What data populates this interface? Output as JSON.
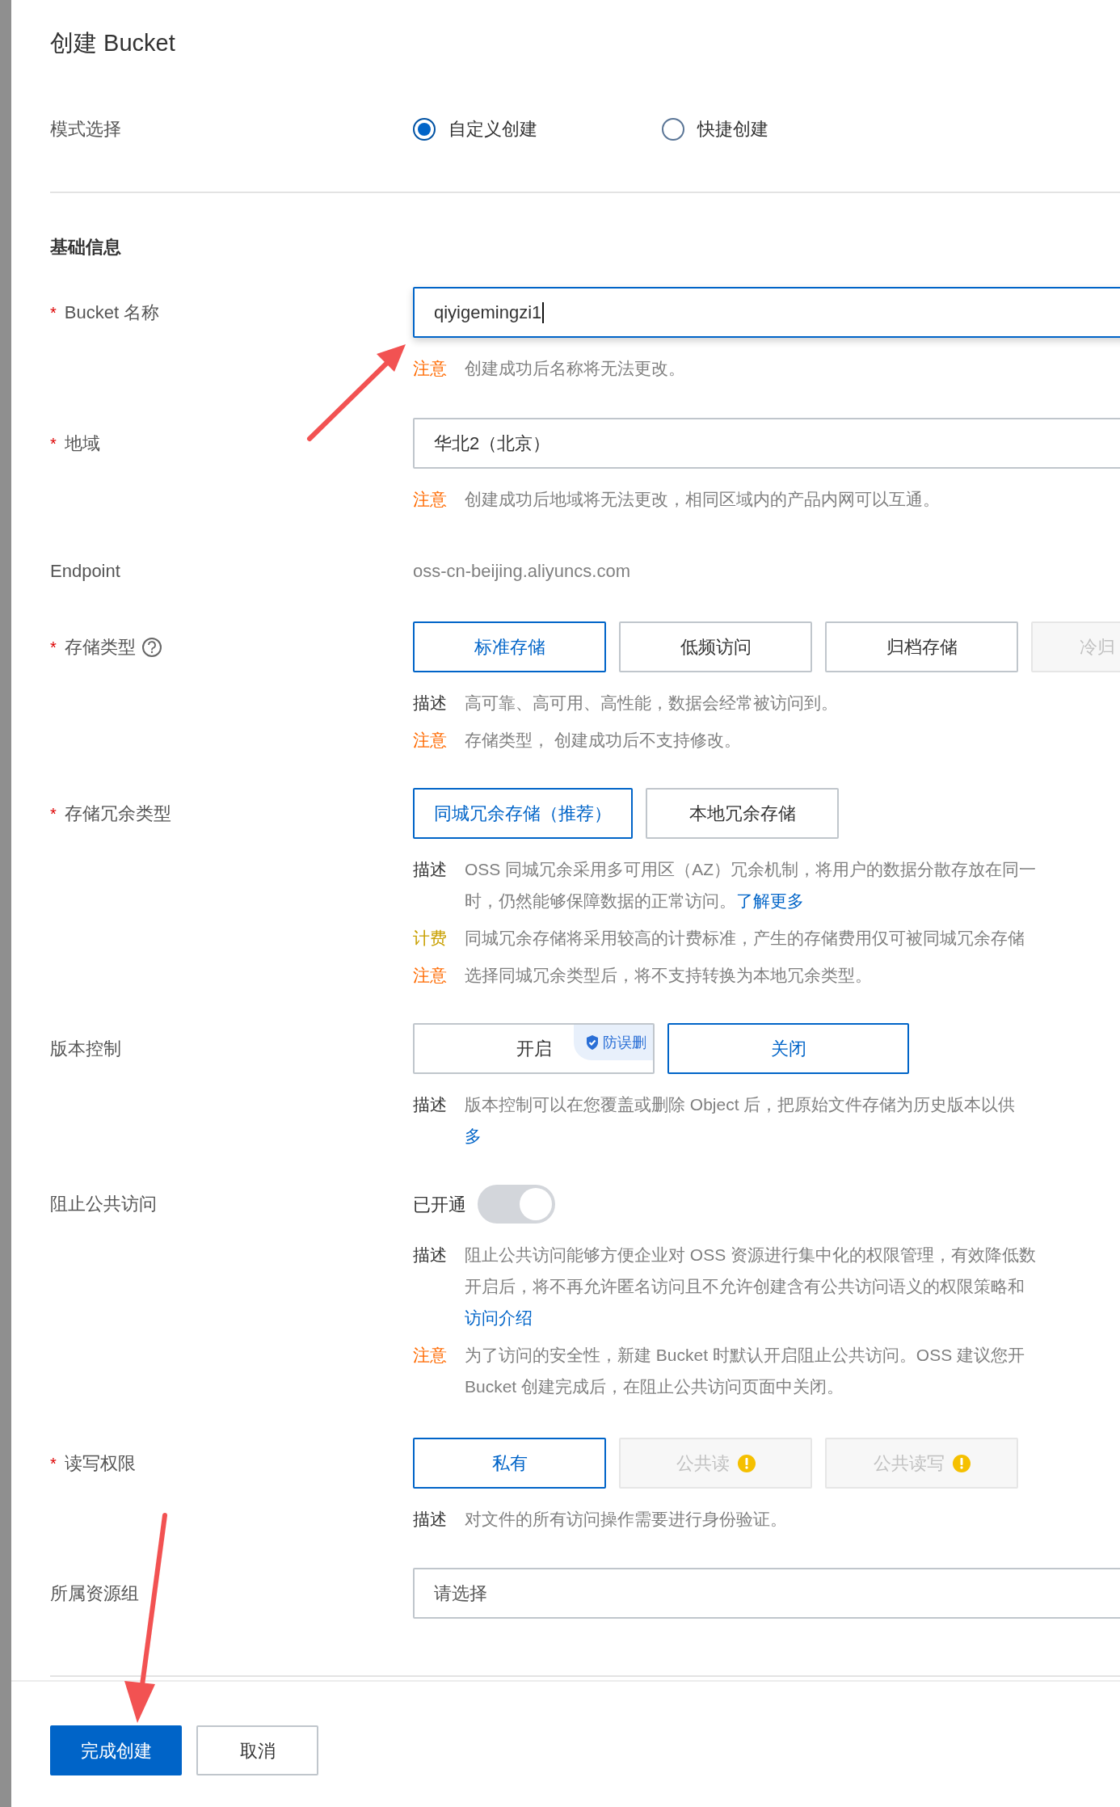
{
  "title": "创建 Bucket",
  "mode": {
    "label": "模式选择",
    "options": [
      {
        "label": "自定义创建",
        "selected": true
      },
      {
        "label": "快捷创建",
        "selected": false
      }
    ]
  },
  "section": "基础信息",
  "fields": [
    {
      "kind": "input",
      "label": "Bucket 名称",
      "required_mark": "*",
      "value": "qiyigemingzi1",
      "focused": true,
      "notes": [
        {
          "kind": "note",
          "tag": "注意",
          "lines": [
            {
              "text": "创建成功后名称将无法更改。"
            }
          ]
        }
      ]
    },
    {
      "kind": "select",
      "label": "地域",
      "required_mark": "*",
      "value": "华北2（北京）",
      "notes": [
        {
          "kind": "note",
          "tag": "注意",
          "lines": [
            {
              "text": "创建成功后地域将无法更改，相同区域内的产品内网可以互通。"
            }
          ]
        }
      ]
    },
    {
      "kind": "text",
      "label": "Endpoint",
      "value": "oss-cn-beijing.aliyuncs.com"
    },
    {
      "kind": "choice",
      "label": "存储类型",
      "required_mark": "*",
      "help": true,
      "options": [
        {
          "label": "标准存储",
          "selected": true,
          "disabled": false
        },
        {
          "label": "低频访问",
          "selected": false,
          "disabled": false
        },
        {
          "label": "归档存储",
          "selected": false,
          "disabled": false
        },
        {
          "label": "冷归",
          "selected": false,
          "disabled": true
        }
      ],
      "notes": [
        {
          "kind": "desc",
          "tag": "描述",
          "lines": [
            {
              "text": "高可靠、高可用、高性能，数据会经常被访问到。"
            }
          ]
        },
        {
          "kind": "note",
          "tag": "注意",
          "lines": [
            {
              "text": "存储类型， 创建成功后不支持修改。"
            }
          ]
        }
      ]
    },
    {
      "kind": "choice",
      "label": "存储冗余类型",
      "required_mark": "*",
      "options": [
        {
          "label": "同城冗余存储（推荐）",
          "selected": true,
          "disabled": false
        },
        {
          "label": "本地冗余存储",
          "selected": false,
          "disabled": false
        }
      ],
      "notes": [
        {
          "kind": "desc",
          "tag": "描述",
          "lines": [
            {
              "text": "OSS 同城冗余采用多可用区（AZ）冗余机制，将用户的数据分散存放在同一"
            },
            {
              "text": "时，仍然能够保障数据的正常访问。",
              "link": "了解更多"
            }
          ]
        },
        {
          "kind": "billing",
          "tag": "计费",
          "lines": [
            {
              "text": "同城冗余存储将采用较高的计费标准，产生的存储费用仅可被同城冗余存储"
            }
          ]
        },
        {
          "kind": "note",
          "tag": "注意",
          "lines": [
            {
              "text": "选择同城冗余类型后，将不支持转换为本地冗余类型。"
            }
          ]
        }
      ]
    },
    {
      "kind": "choice",
      "label": "版本控制",
      "wide": true,
      "options": [
        {
          "label": "开启",
          "selected": false,
          "disabled": false,
          "badge": "防误删"
        },
        {
          "label": "关闭",
          "selected": true,
          "disabled": false
        }
      ],
      "notes": [
        {
          "kind": "desc",
          "tag": "描述",
          "lines": [
            {
              "text": "版本控制可以在您覆盖或删除 Object 后，把原始文件存储为历史版本以供"
            },
            {
              "link": "多"
            }
          ]
        }
      ]
    },
    {
      "kind": "toggle",
      "label": "阻止公共访问",
      "status": "已开通",
      "on": true,
      "disabled": true,
      "notes": [
        {
          "kind": "desc",
          "tag": "描述",
          "lines": [
            {
              "text": "阻止公共访问能够方便企业对 OSS 资源进行集中化的权限管理，有效降低数"
            },
            {
              "text": "开启后，将不再允许匿名访问且不允许创建含有公共访问语义的权限策略和"
            },
            {
              "link": "访问介绍"
            }
          ]
        },
        {
          "kind": "note",
          "tag": "注意",
          "lines": [
            {
              "text": "为了访问的安全性，新建 Bucket 时默认开启阻止公共访问。OSS 建议您开"
            },
            {
              "text": "Bucket 创建完成后，在阻止公共访问页面中关闭。"
            }
          ]
        }
      ]
    },
    {
      "kind": "choice",
      "label": "读写权限",
      "required_mark": "*",
      "options": [
        {
          "label": "私有",
          "selected": true,
          "disabled": false
        },
        {
          "label": "公共读",
          "selected": false,
          "disabled": true,
          "warning": true
        },
        {
          "label": "公共读写",
          "selected": false,
          "disabled": true,
          "warning": true
        }
      ],
      "notes": [
        {
          "kind": "desc",
          "tag": "描述",
          "lines": [
            {
              "text": "对文件的所有访问操作需要进行身份验证。"
            }
          ]
        }
      ]
    },
    {
      "kind": "select",
      "label": "所属资源组",
      "placeholder": "请选择"
    }
  ],
  "footer": [
    {
      "label": "完成创建",
      "kind": "primary"
    },
    {
      "label": "取消",
      "kind": "default"
    }
  ]
}
